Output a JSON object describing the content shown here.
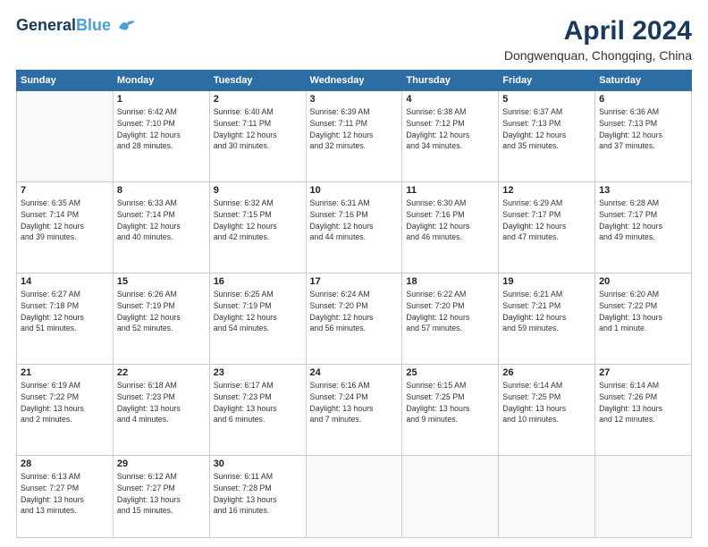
{
  "logo": {
    "line1": "General",
    "line2": "Blue"
  },
  "header": {
    "month_year": "April 2024",
    "location": "Dongwenquan, Chongqing, China"
  },
  "days_of_week": [
    "Sunday",
    "Monday",
    "Tuesday",
    "Wednesday",
    "Thursday",
    "Friday",
    "Saturday"
  ],
  "weeks": [
    [
      {
        "day": "",
        "info": ""
      },
      {
        "day": "1",
        "info": "Sunrise: 6:42 AM\nSunset: 7:10 PM\nDaylight: 12 hours\nand 28 minutes."
      },
      {
        "day": "2",
        "info": "Sunrise: 6:40 AM\nSunset: 7:11 PM\nDaylight: 12 hours\nand 30 minutes."
      },
      {
        "day": "3",
        "info": "Sunrise: 6:39 AM\nSunset: 7:11 PM\nDaylight: 12 hours\nand 32 minutes."
      },
      {
        "day": "4",
        "info": "Sunrise: 6:38 AM\nSunset: 7:12 PM\nDaylight: 12 hours\nand 34 minutes."
      },
      {
        "day": "5",
        "info": "Sunrise: 6:37 AM\nSunset: 7:13 PM\nDaylight: 12 hours\nand 35 minutes."
      },
      {
        "day": "6",
        "info": "Sunrise: 6:36 AM\nSunset: 7:13 PM\nDaylight: 12 hours\nand 37 minutes."
      }
    ],
    [
      {
        "day": "7",
        "info": "Sunrise: 6:35 AM\nSunset: 7:14 PM\nDaylight: 12 hours\nand 39 minutes."
      },
      {
        "day": "8",
        "info": "Sunrise: 6:33 AM\nSunset: 7:14 PM\nDaylight: 12 hours\nand 40 minutes."
      },
      {
        "day": "9",
        "info": "Sunrise: 6:32 AM\nSunset: 7:15 PM\nDaylight: 12 hours\nand 42 minutes."
      },
      {
        "day": "10",
        "info": "Sunrise: 6:31 AM\nSunset: 7:16 PM\nDaylight: 12 hours\nand 44 minutes."
      },
      {
        "day": "11",
        "info": "Sunrise: 6:30 AM\nSunset: 7:16 PM\nDaylight: 12 hours\nand 46 minutes."
      },
      {
        "day": "12",
        "info": "Sunrise: 6:29 AM\nSunset: 7:17 PM\nDaylight: 12 hours\nand 47 minutes."
      },
      {
        "day": "13",
        "info": "Sunrise: 6:28 AM\nSunset: 7:17 PM\nDaylight: 12 hours\nand 49 minutes."
      }
    ],
    [
      {
        "day": "14",
        "info": "Sunrise: 6:27 AM\nSunset: 7:18 PM\nDaylight: 12 hours\nand 51 minutes."
      },
      {
        "day": "15",
        "info": "Sunrise: 6:26 AM\nSunset: 7:19 PM\nDaylight: 12 hours\nand 52 minutes."
      },
      {
        "day": "16",
        "info": "Sunrise: 6:25 AM\nSunset: 7:19 PM\nDaylight: 12 hours\nand 54 minutes."
      },
      {
        "day": "17",
        "info": "Sunrise: 6:24 AM\nSunset: 7:20 PM\nDaylight: 12 hours\nand 56 minutes."
      },
      {
        "day": "18",
        "info": "Sunrise: 6:22 AM\nSunset: 7:20 PM\nDaylight: 12 hours\nand 57 minutes."
      },
      {
        "day": "19",
        "info": "Sunrise: 6:21 AM\nSunset: 7:21 PM\nDaylight: 12 hours\nand 59 minutes."
      },
      {
        "day": "20",
        "info": "Sunrise: 6:20 AM\nSunset: 7:22 PM\nDaylight: 13 hours\nand 1 minute."
      }
    ],
    [
      {
        "day": "21",
        "info": "Sunrise: 6:19 AM\nSunset: 7:22 PM\nDaylight: 13 hours\nand 2 minutes."
      },
      {
        "day": "22",
        "info": "Sunrise: 6:18 AM\nSunset: 7:23 PM\nDaylight: 13 hours\nand 4 minutes."
      },
      {
        "day": "23",
        "info": "Sunrise: 6:17 AM\nSunset: 7:23 PM\nDaylight: 13 hours\nand 6 minutes."
      },
      {
        "day": "24",
        "info": "Sunrise: 6:16 AM\nSunset: 7:24 PM\nDaylight: 13 hours\nand 7 minutes."
      },
      {
        "day": "25",
        "info": "Sunrise: 6:15 AM\nSunset: 7:25 PM\nDaylight: 13 hours\nand 9 minutes."
      },
      {
        "day": "26",
        "info": "Sunrise: 6:14 AM\nSunset: 7:25 PM\nDaylight: 13 hours\nand 10 minutes."
      },
      {
        "day": "27",
        "info": "Sunrise: 6:14 AM\nSunset: 7:26 PM\nDaylight: 13 hours\nand 12 minutes."
      }
    ],
    [
      {
        "day": "28",
        "info": "Sunrise: 6:13 AM\nSunset: 7:27 PM\nDaylight: 13 hours\nand 13 minutes."
      },
      {
        "day": "29",
        "info": "Sunrise: 6:12 AM\nSunset: 7:27 PM\nDaylight: 13 hours\nand 15 minutes."
      },
      {
        "day": "30",
        "info": "Sunrise: 6:11 AM\nSunset: 7:28 PM\nDaylight: 13 hours\nand 16 minutes."
      },
      {
        "day": "",
        "info": ""
      },
      {
        "day": "",
        "info": ""
      },
      {
        "day": "",
        "info": ""
      },
      {
        "day": "",
        "info": ""
      }
    ]
  ]
}
